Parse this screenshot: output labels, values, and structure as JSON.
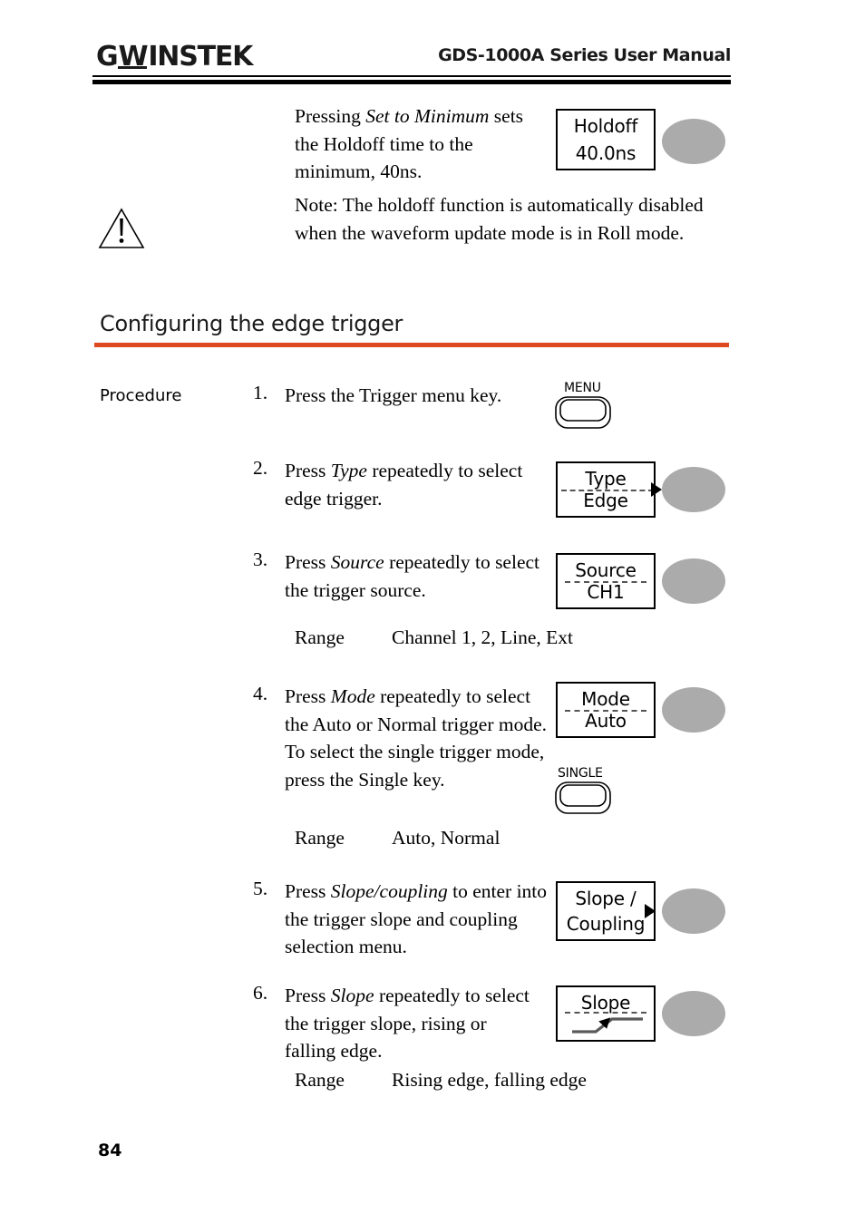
{
  "header": {
    "logo_gw": "G",
    "logo_w": "W",
    "logo_instek": "INSTEK",
    "title": "GDS-1000A Series User Manual"
  },
  "intro": {
    "paragraph1_html": "Pressing <i>Set to Minimum</i> sets the Holdoff time to the minimum, 40ns.",
    "paragraph1_plain": "Pressing Set to Minimum sets the Holdoff time to the minimum, 40ns.",
    "note": "Note: The holdoff function is automatically disabled when the waveform update mode is in Roll mode.",
    "warning_icon": "warning-triangle-icon",
    "holdoff_box": {
      "top": "Holdoff",
      "bottom": "40.0ns"
    }
  },
  "section": {
    "heading": "Configuring the edge trigger",
    "rule_color": "#DD4A1F",
    "procedure_label": "Procedure"
  },
  "steps": [
    {
      "number": "1.",
      "text_html": "Press the Trigger menu key.",
      "text_plain": "Press the Trigger menu key.",
      "key": {
        "label": "MENU",
        "name": "menu-key"
      }
    },
    {
      "number": "2.",
      "text_html": "Press <i>Type</i> repeatedly to select edge trigger.",
      "text_plain": "Press Type repeatedly to select edge trigger.",
      "box": {
        "top": "Type",
        "bottom": "Edge",
        "divider": "dashed-arrow"
      }
    },
    {
      "number": "3.",
      "text_html": "Press <i>Source</i> repeatedly to select the trigger source.",
      "text_plain": "Press Source repeatedly to select the trigger source.",
      "box": {
        "top": "Source",
        "bottom": "CH1",
        "divider": "dashed"
      },
      "range": {
        "label": "Range",
        "value": "Channel 1, 2, Line, Ext"
      }
    },
    {
      "number": "4.",
      "text_html": "Press <i>Mode</i> repeatedly to select the Auto or Normal trigger mode. To select the single trigger mode, press the Single key.",
      "text_plain": "Press Mode repeatedly to select the Auto or Normal trigger mode. To select the single trigger mode, press the Single key.",
      "box": {
        "top": "Mode",
        "bottom": "Auto",
        "divider": "dashed"
      },
      "key": {
        "label": "SINGLE",
        "name": "single-key"
      },
      "range": {
        "label": "Range",
        "value": "Auto, Normal"
      }
    },
    {
      "number": "5.",
      "text_html": "Press <i>Slope/coupling</i> to enter into the trigger slope and coupling selection menu.",
      "text_plain": "Press Slope/coupling to enter into the trigger slope and coupling selection menu.",
      "box": {
        "top": "Slope /",
        "bottom": "Coupling",
        "divider": "arrow-only"
      }
    },
    {
      "number": "6.",
      "text_html": "Press <i>Slope</i> repeatedly to select the trigger slope, rising or falling edge.",
      "text_plain": "Press Slope repeatedly to select the trigger slope, rising or falling edge.",
      "box": {
        "top": "Slope",
        "bottom": "",
        "divider": "dashed",
        "icon": "rising-edge-icon"
      },
      "range": {
        "label": "Range",
        "value": "Rising edge, falling edge"
      }
    }
  ],
  "footer": {
    "page_number": "84"
  },
  "colors": {
    "accent_orange": "#DD4A1F",
    "knob_gray": "#ABABAB",
    "text_black": "#000000"
  }
}
